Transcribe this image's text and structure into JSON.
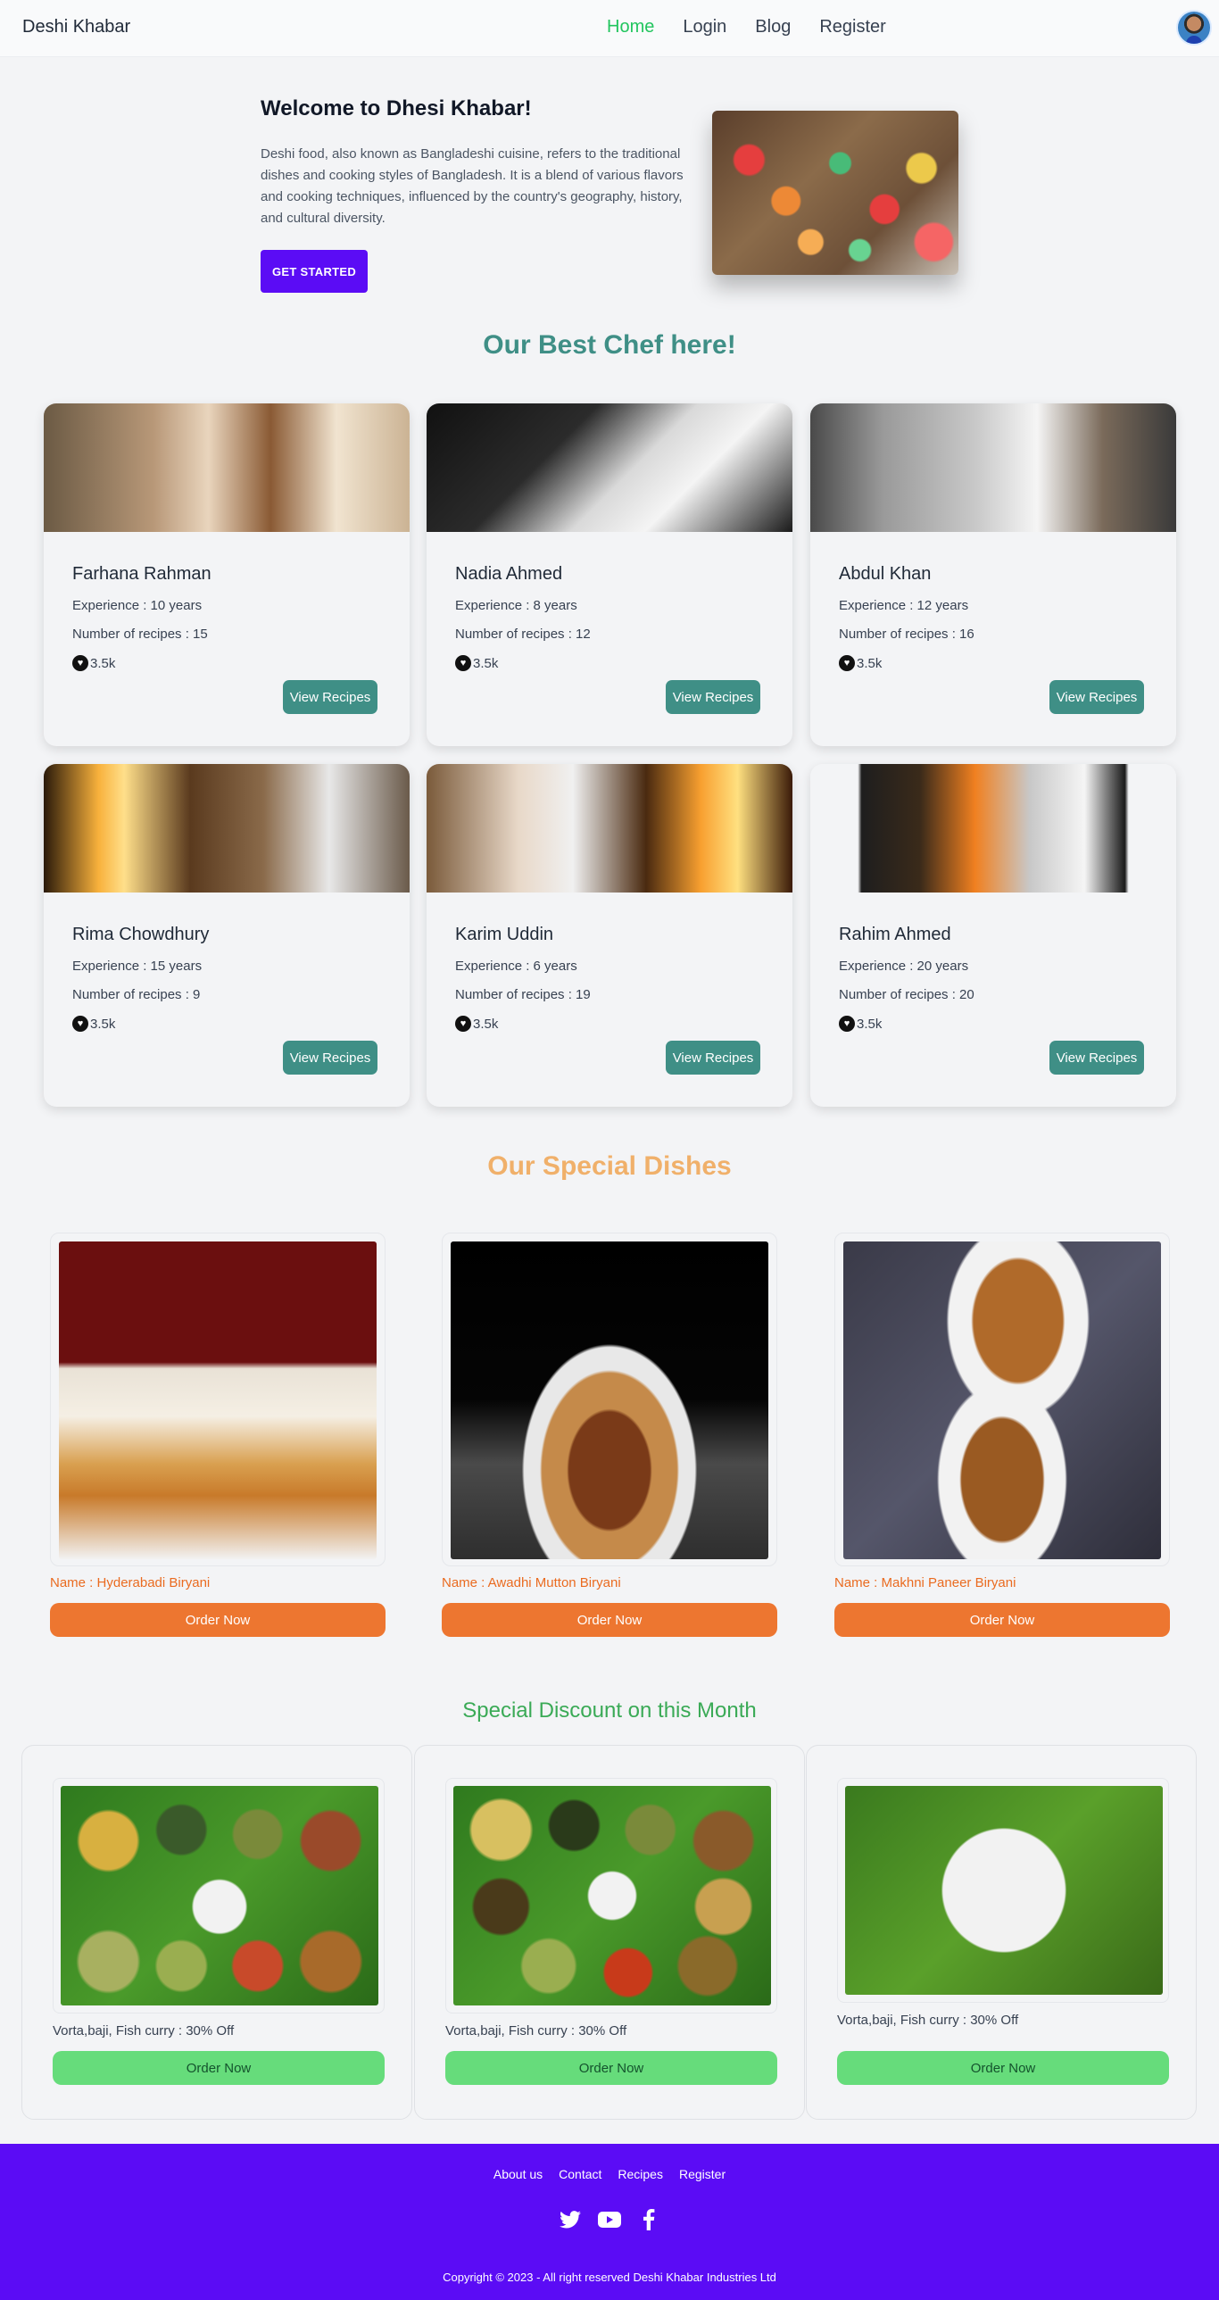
{
  "navbar": {
    "brand": "Deshi Khabar",
    "links": [
      "Home",
      "Login",
      "Blog",
      "Register"
    ],
    "active": "Home"
  },
  "hero": {
    "title": "Welcome to Dhesi Khabar!",
    "text": "Deshi food, also known as Bangladeshi cuisine, refers to the traditional dishes and cooking styles of Bangladesh. It is a blend of various flavors and cooking techniques, influenced by the country's geography, history, and cultural diversity.",
    "button": "GET STARTED"
  },
  "chefs": {
    "title": "Our Best Chef here!",
    "button": "View Recipes",
    "items": [
      {
        "name": "Farhana Rahman",
        "experience": "Experience : 10 years",
        "recipes": "Number of recipes : 15",
        "likes": "3.5k"
      },
      {
        "name": "Nadia Ahmed",
        "experience": "Experience : 8 years",
        "recipes": "Number of recipes : 12",
        "likes": "3.5k"
      },
      {
        "name": "Abdul Khan",
        "experience": "Experience : 12 years",
        "recipes": "Number of recipes : 16",
        "likes": "3.5k"
      },
      {
        "name": "Rima Chowdhury",
        "experience": "Experience : 15 years",
        "recipes": "Number of recipes : 9",
        "likes": "3.5k"
      },
      {
        "name": "Karim Uddin",
        "experience": "Experience : 6 years",
        "recipes": "Number of recipes : 19",
        "likes": "3.5k"
      },
      {
        "name": "Rahim Ahmed",
        "experience": "Experience : 20 years",
        "recipes": "Number of recipes : 20",
        "likes": "3.5k"
      }
    ]
  },
  "dishes": {
    "title": "Our Special Dishes",
    "button": "Order Now",
    "items": [
      {
        "name": "Name : Hyderabadi Biryani"
      },
      {
        "name": "Name : Awadhi Mutton Biryani"
      },
      {
        "name": "Name : Makhni Paneer Biryani"
      }
    ]
  },
  "discount": {
    "title": "Special Discount on this Month",
    "button": "Order Now",
    "items": [
      {
        "text": "Vorta,baji, Fish curry : 30% Off"
      },
      {
        "text": "Vorta,baji, Fish curry : 30% Off"
      },
      {
        "text": "Vorta,baji, Fish curry : 30% Off"
      }
    ]
  },
  "footer": {
    "links": [
      "About us",
      "Contact",
      "Recipes",
      "Register"
    ],
    "social": [
      "twitter-icon",
      "youtube-icon",
      "facebook-icon"
    ],
    "copyright": "Copyright © 2023 - All right reserved Deshi Khabar Industries Ltd"
  },
  "colors": {
    "primary": "#5b0cf5",
    "teal": "#3f8f86",
    "orange": "#ed7630",
    "green": "#66dc7b",
    "active_nav": "#22c55e"
  }
}
